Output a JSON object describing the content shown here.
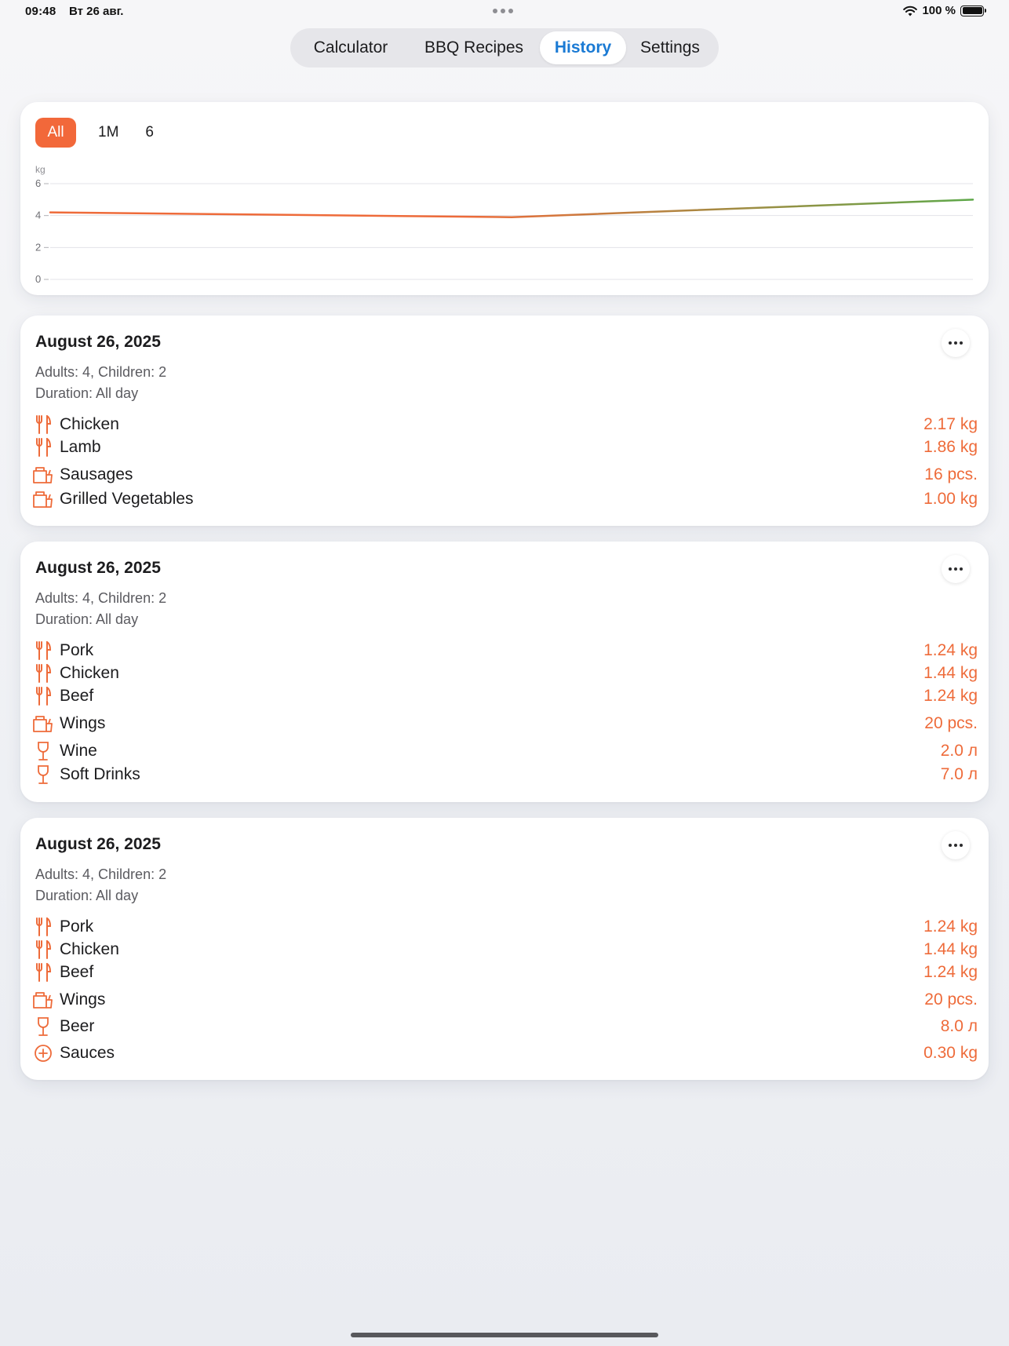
{
  "status_bar": {
    "time": "09:48",
    "date": "Вт 26 авг.",
    "battery": "100 %"
  },
  "tabs": [
    {
      "label": "Calculator",
      "active": false
    },
    {
      "label": "BBQ Recipes",
      "active": false
    },
    {
      "label": "History",
      "active": true
    },
    {
      "label": "Settings",
      "active": false
    }
  ],
  "colors": {
    "accent": "#f2683a",
    "value_text": "#ee6b3a",
    "active_tab": "#1a7ad4",
    "line_start": "#ee6b3a",
    "line_end": "#5ea84a"
  },
  "chart": {
    "range_buttons": [
      {
        "label": "All",
        "active": true
      },
      {
        "label": "1M",
        "active": false
      },
      {
        "label": "6",
        "active": false
      }
    ]
  },
  "chart_data": {
    "type": "line",
    "ylabel": "kg",
    "ylim": [
      0,
      6
    ],
    "yticks": [
      0,
      2,
      4,
      6
    ],
    "grid": true,
    "x": [
      0,
      1,
      2
    ],
    "values": [
      4.2,
      3.9,
      5.0
    ]
  },
  "history": [
    {
      "date": "August 26, 2025",
      "people": "Adults: 4, Children: 2",
      "duration": "Duration: All day",
      "items": [
        {
          "icon": "fork-knife-icon",
          "name": "Chicken",
          "value": "2.17 kg"
        },
        {
          "icon": "fork-knife-icon",
          "name": "Lamb",
          "value": "1.86 kg"
        },
        {
          "icon": "takeout-bag-icon",
          "name": "Sausages",
          "value": "16 pcs."
        },
        {
          "icon": "takeout-bag-icon",
          "name": "Grilled Vegetables",
          "value": "1.00 kg"
        }
      ]
    },
    {
      "date": "August 26, 2025",
      "people": "Adults: 4, Children: 2",
      "duration": "Duration: All day",
      "items": [
        {
          "icon": "fork-knife-icon",
          "name": "Pork",
          "value": "1.24 kg"
        },
        {
          "icon": "fork-knife-icon",
          "name": "Chicken",
          "value": "1.44 kg"
        },
        {
          "icon": "fork-knife-icon",
          "name": "Beef",
          "value": "1.24 kg"
        },
        {
          "icon": "takeout-bag-icon",
          "name": "Wings",
          "value": "20 pcs."
        },
        {
          "icon": "wine-glass-icon",
          "name": "Wine",
          "value": "2.0 л"
        },
        {
          "icon": "wine-glass-icon",
          "name": "Soft Drinks",
          "value": "7.0 л"
        }
      ]
    },
    {
      "date": "August 26, 2025",
      "people": "Adults: 4, Children: 2",
      "duration": "Duration: All day",
      "items": [
        {
          "icon": "fork-knife-icon",
          "name": "Pork",
          "value": "1.24 kg"
        },
        {
          "icon": "fork-knife-icon",
          "name": "Chicken",
          "value": "1.44 kg"
        },
        {
          "icon": "fork-knife-icon",
          "name": "Beef",
          "value": "1.24 kg"
        },
        {
          "icon": "takeout-bag-icon",
          "name": "Wings",
          "value": "20 pcs."
        },
        {
          "icon": "wine-glass-icon",
          "name": "Beer",
          "value": "8.0 л"
        },
        {
          "icon": "plus-circle-icon",
          "name": "Sauces",
          "value": "0.30 kg"
        }
      ]
    }
  ]
}
